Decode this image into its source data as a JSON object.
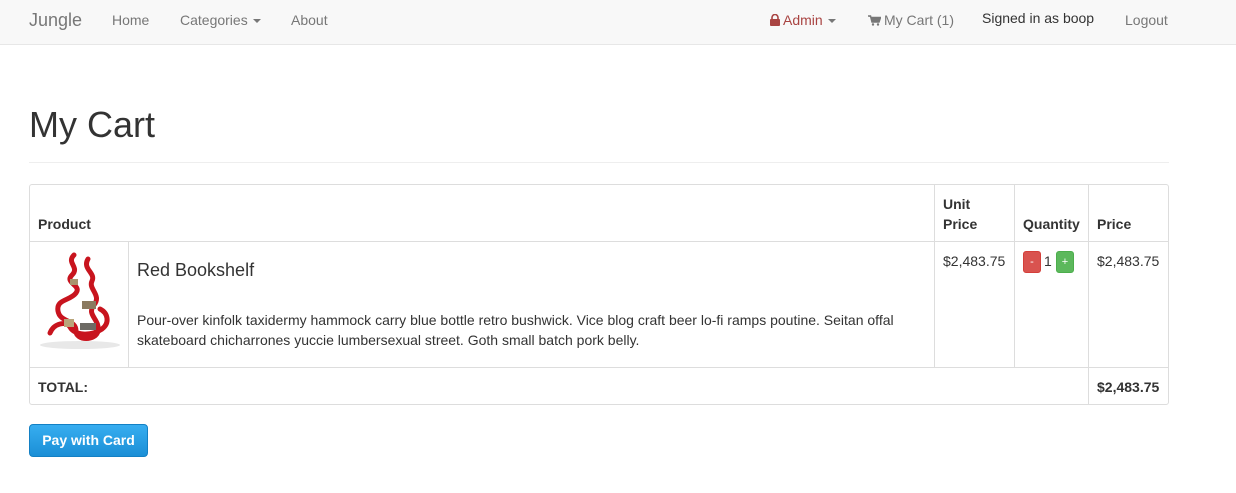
{
  "nav": {
    "brand": "Jungle",
    "home": "Home",
    "categories": "Categories",
    "about": "About",
    "admin": "Admin",
    "cart": "My Cart (1)",
    "signed_in": "Signed in as boop",
    "logout": "Logout"
  },
  "page": {
    "title": "My Cart"
  },
  "table": {
    "headers": {
      "product": "Product",
      "unit_price_1": "Unit",
      "unit_price_2": "Price",
      "quantity": "Quantity",
      "price": "Price"
    },
    "rows": [
      {
        "name": "Red Bookshelf",
        "description": "Pour-over kinfolk taxidermy hammock carry blue bottle retro bushwick. Vice blog craft beer lo-fi ramps poutine. Seitan offal skateboard chicharrones yuccie lumbersexual street. Goth small batch pork belly.",
        "unit_price": "$2,483.75",
        "quantity": "1",
        "minus": "-",
        "plus": "+",
        "price": "$2,483.75"
      }
    ],
    "total_label": "TOTAL:",
    "total_value": "$2,483.75"
  },
  "actions": {
    "pay": "Pay with Card"
  },
  "colors": {
    "admin": "#a94442",
    "pay_button": "#1b8fd6",
    "minus": "#d9534f",
    "plus": "#5cb85c"
  }
}
